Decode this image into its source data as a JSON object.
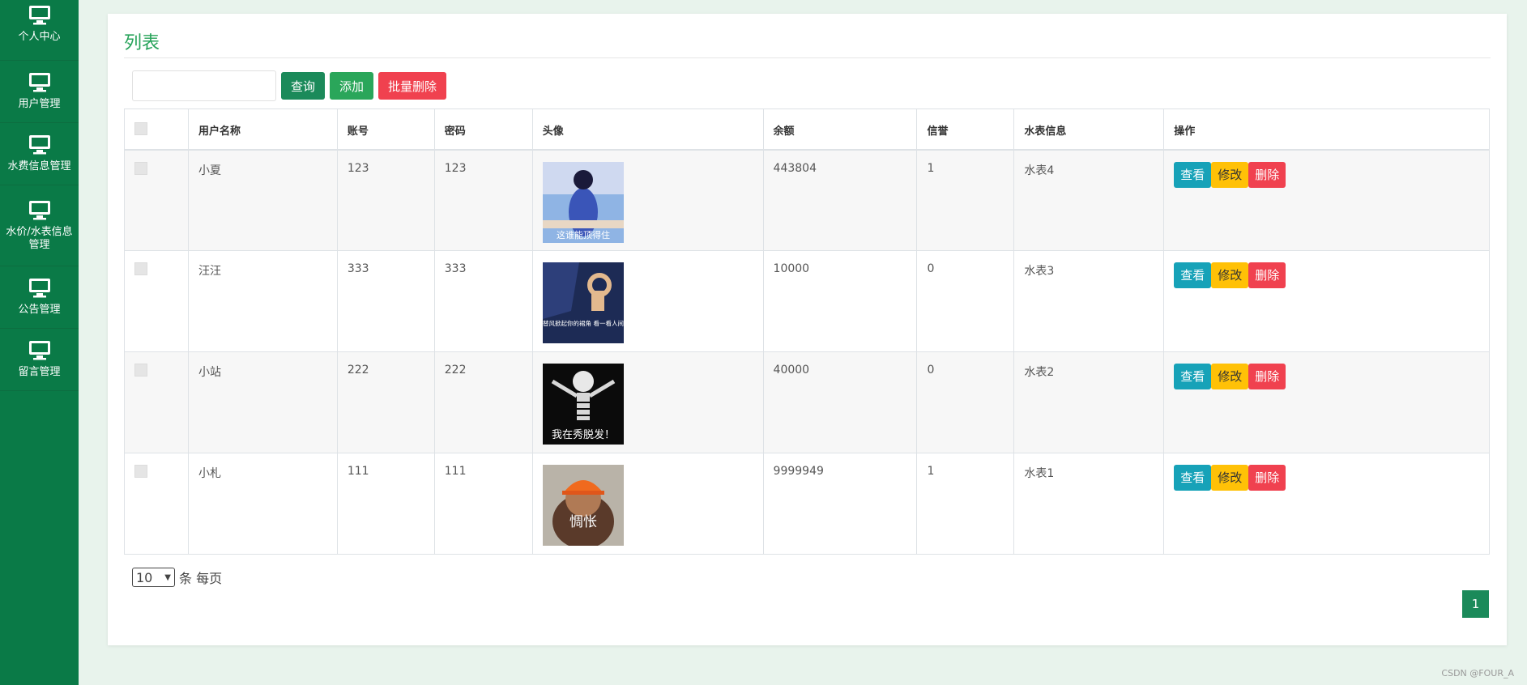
{
  "sidebar": {
    "items": [
      {
        "label": "个人中心",
        "icon": "monitor-icon"
      },
      {
        "label": "用户管理",
        "icon": "monitor-icon"
      },
      {
        "label": "水费信息管理",
        "icon": "monitor-icon"
      },
      {
        "label": "水价/水表信息管理",
        "icon": "monitor-icon"
      },
      {
        "label": "公告管理",
        "icon": "monitor-icon"
      },
      {
        "label": "留言管理",
        "icon": "monitor-icon"
      }
    ]
  },
  "page": {
    "title": "列表"
  },
  "toolbar": {
    "search_value": "",
    "search_label": "查询",
    "add_label": "添加",
    "batch_delete_label": "批量删除"
  },
  "table": {
    "columns": [
      "用户名称",
      "账号",
      "密码",
      "头像",
      "余额",
      "信誉",
      "水表信息",
      "操作"
    ],
    "rows": [
      {
        "name": "小夏",
        "account": "123",
        "password": "123",
        "avatar_caption": "这谁能顶得住",
        "balance": "443804",
        "credit": "1",
        "meter": "水表4"
      },
      {
        "name": "汪汪",
        "account": "333",
        "password": "333",
        "avatar_caption": "好想替风掀起你的裙角 看一看人间仙境",
        "balance": "10000",
        "credit": "0",
        "meter": "水表3"
      },
      {
        "name": "小站",
        "account": "222",
        "password": "222",
        "avatar_caption": "我在秀脱发！",
        "balance": "40000",
        "credit": "0",
        "meter": "水表2"
      },
      {
        "name": "小札",
        "account": "111",
        "password": "111",
        "avatar_caption": "惆怅",
        "balance": "9999949",
        "credit": "1",
        "meter": "水表1"
      }
    ],
    "actions": {
      "view": "查看",
      "edit": "修改",
      "delete": "删除"
    }
  },
  "pagination": {
    "page_size": "10",
    "page_size_suffix": "条 每页",
    "current_page": "1"
  },
  "footer": {
    "watermark": "CSDN @FOUR_A"
  },
  "colors": {
    "sidebar": "#0a7a47",
    "accent": "#27a35a",
    "view": "#17a2b8",
    "edit": "#ffc107",
    "delete": "#f0414f"
  }
}
